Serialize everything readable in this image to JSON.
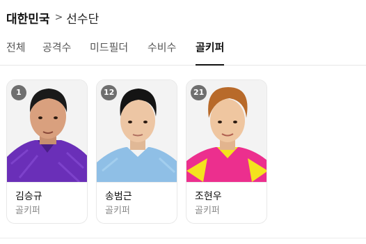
{
  "breadcrumb": {
    "root": "대한민국",
    "separator": ">",
    "current": "선수단"
  },
  "tabs": [
    {
      "label": "전체",
      "active": false
    },
    {
      "label": "공격수",
      "active": false
    },
    {
      "label": "미드필더",
      "active": false
    },
    {
      "label": "수비수",
      "active": false
    },
    {
      "label": "골키퍼",
      "active": true
    }
  ],
  "players": [
    {
      "number": "1",
      "name": "김승규",
      "position": "골키퍼",
      "jersey_color": "#6a2fb8"
    },
    {
      "number": "12",
      "name": "송범근",
      "position": "골키퍼",
      "jersey_color": "#8fbfe6"
    },
    {
      "number": "21",
      "name": "조현우",
      "position": "골키퍼",
      "jersey_color": "#ec2f8e"
    }
  ]
}
